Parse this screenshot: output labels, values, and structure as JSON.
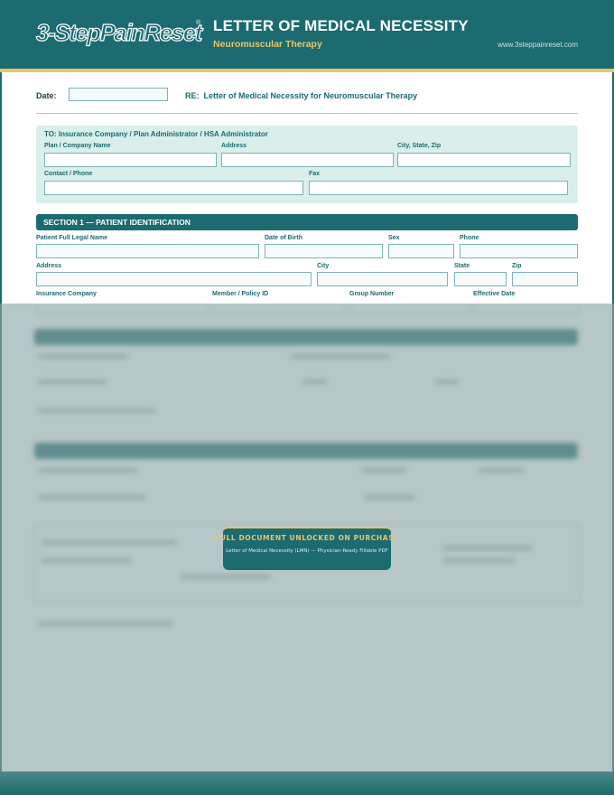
{
  "header": {
    "logo_text": "3-StepPainReset",
    "logo_mark": "®",
    "title": "LETTER OF MEDICAL NECESSITY",
    "subtitle": "Neuromuscular Therapy",
    "website": "www.3steppainreset.com"
  },
  "letter": {
    "date_label": "Date:",
    "date_value": "",
    "re_label": "RE:",
    "re_text": "Letter of Medical Necessity for Neuromuscular Therapy"
  },
  "recipient": {
    "title": "TO:  Insurance Company / Plan Administrator / HSA Administrator",
    "fields": {
      "plan_name": {
        "label": "Plan / Company Name",
        "value": ""
      },
      "address": {
        "label": "Address",
        "value": ""
      },
      "city_state_zip": {
        "label": "City, State, Zip",
        "value": ""
      },
      "contact_phone": {
        "label": "Contact / Phone",
        "value": ""
      },
      "fax": {
        "label": "Fax",
        "value": ""
      }
    }
  },
  "section1": {
    "title": "SECTION 1 — PATIENT IDENTIFICATION",
    "fields": {
      "full_name": {
        "label": "Patient Full Legal Name",
        "value": ""
      },
      "dob": {
        "label": "Date of Birth",
        "value": ""
      },
      "sex": {
        "label": "Sex",
        "value": ""
      },
      "phone": {
        "label": "Phone",
        "value": ""
      },
      "address": {
        "label": "Address",
        "value": ""
      },
      "city": {
        "label": "City",
        "value": ""
      },
      "state": {
        "label": "State",
        "value": ""
      },
      "zip": {
        "label": "Zip",
        "value": ""
      },
      "insurance_company": {
        "label": "Insurance Company",
        "value": ""
      },
      "member_id": {
        "label": "Member / Policy ID",
        "value": ""
      },
      "group_number": {
        "label": "Group Number",
        "value": ""
      },
      "effective_date": {
        "label": "Effective Date",
        "value": ""
      }
    }
  },
  "paywall": {
    "title": "FULL DOCUMENT UNLOCKED ON PURCHASE",
    "subtitle": "Letter of Medical Necessity (LMN) — Physician-Ready Fillable PDF"
  },
  "colors": {
    "brand_teal": "#1b6b70",
    "accent_gold": "#e9c46a",
    "panel_mint": "#d9efec"
  }
}
